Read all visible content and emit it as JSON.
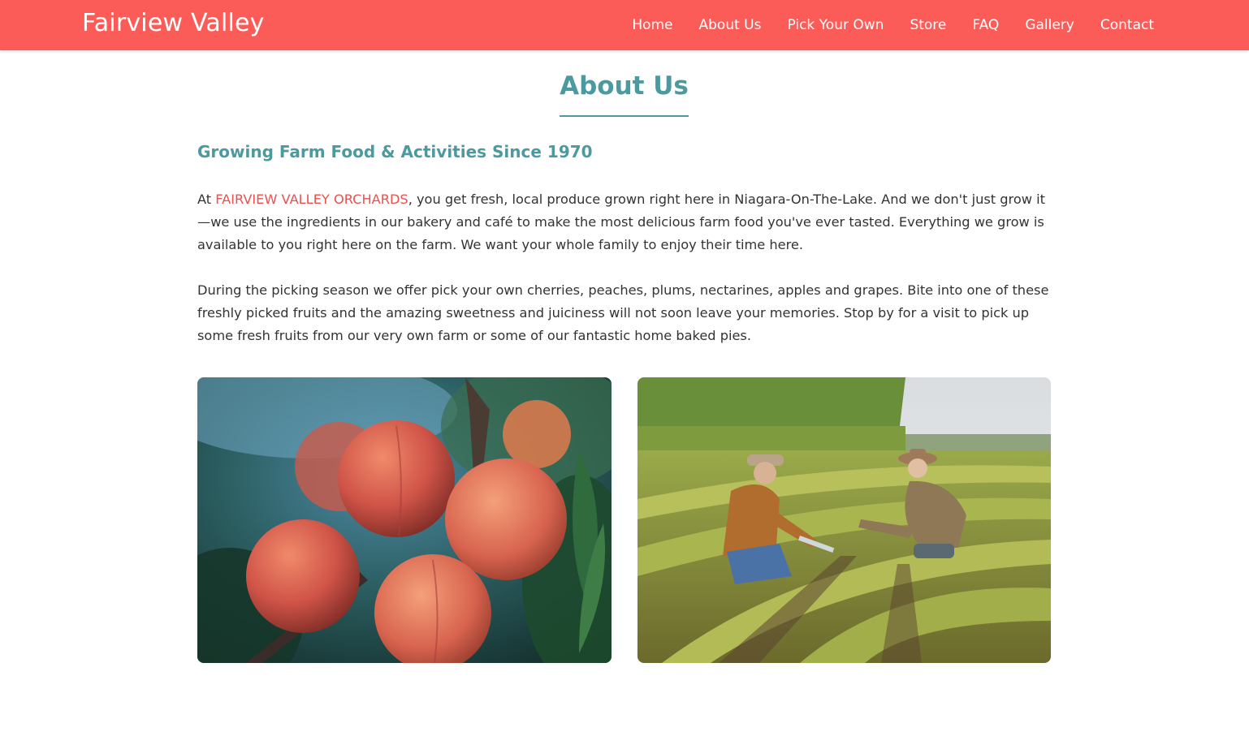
{
  "navbar": {
    "brand": "Fairview Valley",
    "background_color": "#fc5c58",
    "items": [
      {
        "label": "Home"
      },
      {
        "label": "About Us"
      },
      {
        "label": "Pick Your Own"
      },
      {
        "label": "Store"
      },
      {
        "label": "FAQ"
      },
      {
        "label": "Gallery"
      },
      {
        "label": "Contact"
      }
    ]
  },
  "main": {
    "title": "About Us",
    "subtitle": "Growing Farm Food & Activities Since 1970",
    "accent_color": "#4b9aa0",
    "highlight_color": "#e8514d",
    "paragraph1": {
      "prefix": "At ",
      "highlight": "FAIRVIEW VALLEY ORCHARDS",
      "suffix": ", you get fresh, local produce grown right here in Niagara-On-The-Lake. And we don't just grow it—we use the ingredients in our bakery and café to make the most delicious farm food you've ever tasted. Everything we grow is available to you right here on the farm. We want your whole family to enjoy their time here."
    },
    "paragraph2": "During the picking season we offer pick your own cherries, peaches, plums, nectarines, apples and grapes. Bite into one of these freshly picked fruits and the amazing sweetness and juiciness will not soon leave your memories. Stop by for a visit to pick up some fresh fruits from our very own farm or some of our fantastic home baked pies."
  },
  "photos": [
    {
      "subject": "apricots-on-branch-photo"
    },
    {
      "subject": "farmers-in-field-photo"
    }
  ]
}
